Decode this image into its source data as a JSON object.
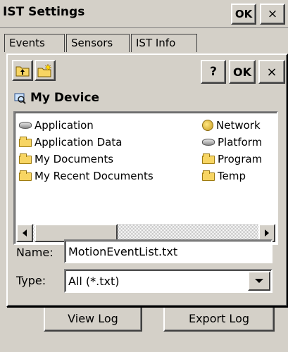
{
  "window": {
    "title": "IST Settings",
    "ok_label": "OK",
    "close_label": "×"
  },
  "tabs": [
    {
      "label": "Events"
    },
    {
      "label": "Sensors"
    },
    {
      "label": "IST Info"
    }
  ],
  "dialog": {
    "help_label": "?",
    "ok_label": "OK",
    "close_label": "×",
    "up_icon": "folder-up-icon",
    "new_folder_icon": "new-folder-icon",
    "location": "My Device",
    "files_col1": [
      {
        "name": "Application",
        "icon": "drive-icon"
      },
      {
        "name": "Application Data",
        "icon": "folder-icon"
      },
      {
        "name": "My Documents",
        "icon": "folder-icon"
      },
      {
        "name": "My Recent Documents",
        "icon": "folder-icon"
      }
    ],
    "files_col2": [
      {
        "name": "Network",
        "icon": "network-icon"
      },
      {
        "name": "Platform",
        "icon": "drive-icon"
      },
      {
        "name": "Program",
        "icon": "folder-icon"
      },
      {
        "name": "Temp",
        "icon": "folder-icon"
      }
    ],
    "name_label": "Name:",
    "name_value": "MotionEventList.txt",
    "type_label": "Type:",
    "type_value": "All (*.txt)"
  },
  "buttons": {
    "view_log": "View Log",
    "export_log": "Export Log"
  },
  "colors": {
    "face": "#d4d0c8",
    "folder": "#f7d563"
  }
}
